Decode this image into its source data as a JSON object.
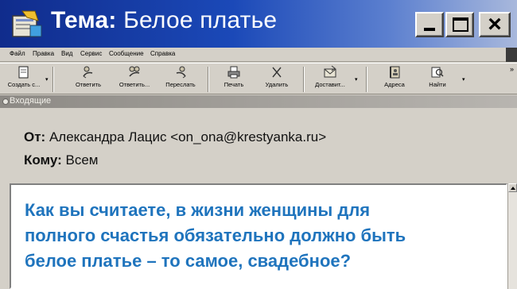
{
  "window": {
    "title_label": "Тема:",
    "title_value": "Белое платье"
  },
  "controls": {
    "minimize": "minimize-icon",
    "maximize": "maximize-icon",
    "close": "×"
  },
  "menu": [
    "Файл",
    "Правка",
    "Вид",
    "Сервис",
    "Сообщение",
    "Справка"
  ],
  "toolbar": {
    "buttons": [
      {
        "label": "Создать с...",
        "icon": "new-message-icon"
      },
      {
        "label": "Ответить",
        "icon": "reply-icon"
      },
      {
        "label": "Ответить...",
        "icon": "reply-all-icon"
      },
      {
        "label": "Переслать",
        "icon": "forward-icon"
      },
      {
        "label": "Печать",
        "icon": "print-icon"
      },
      {
        "label": "Удалить",
        "icon": "delete-icon"
      },
      {
        "label": "Доставит...",
        "icon": "send-receive-icon"
      },
      {
        "label": "Адреса",
        "icon": "address-book-icon"
      },
      {
        "label": "Найти",
        "icon": "find-icon"
      }
    ],
    "more": "»"
  },
  "folder": {
    "name": "Входящие"
  },
  "header": {
    "from_label": "От:",
    "from_value": "Александра Лацис <on_ona@krestyanka.ru>",
    "to_label": "Кому:",
    "to_value": "Всем"
  },
  "message": {
    "lines": [
      "Как вы считаете, в жизни женщины для",
      "полного счастья обязательно должно быть",
      "белое платье – то самое, свадебное?"
    ]
  },
  "colors": {
    "title_gradient_start": "#102c8c",
    "body_text": "#1f74bd"
  }
}
